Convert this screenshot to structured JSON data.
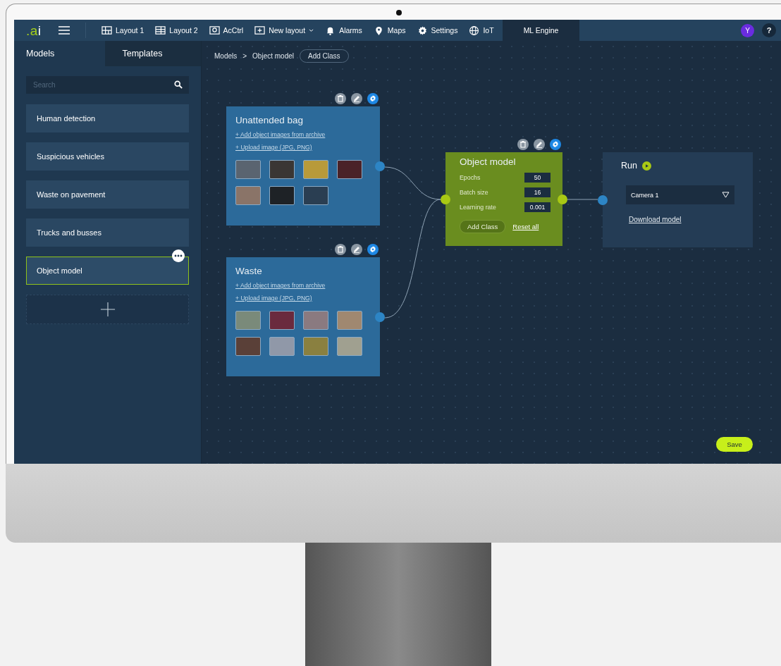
{
  "topbar": {
    "logo": ".ai",
    "nav": [
      {
        "label": "Layout 1",
        "kind": "grid",
        "selected": false
      },
      {
        "label": "Layout 2",
        "kind": "panels",
        "selected": false
      },
      {
        "label": "AcCtrl",
        "kind": "camera",
        "selected": false
      },
      {
        "label": "New layout",
        "kind": "add",
        "selected": false,
        "has_menu": true
      },
      {
        "label": "Alarms",
        "kind": "bell",
        "selected": false
      },
      {
        "label": "Maps",
        "kind": "pin",
        "selected": false
      },
      {
        "label": "Settings",
        "kind": "gear",
        "selected": false
      },
      {
        "label": "IoT",
        "kind": "globe",
        "selected": false
      },
      {
        "label": "ML Engine",
        "kind": "none",
        "selected": true
      }
    ],
    "avatar": "Y",
    "help": "?"
  },
  "sidebar": {
    "tabs": [
      {
        "label": "Models",
        "selected": true
      },
      {
        "label": "Templates",
        "selected": false
      }
    ],
    "search": {
      "placeholder": "Search"
    },
    "items": [
      {
        "label": "Human detection",
        "selected": false
      },
      {
        "label": "Suspicious vehicles",
        "selected": false
      },
      {
        "label": "Waste on pavement",
        "selected": false
      },
      {
        "label": "Trucks and busses",
        "selected": false
      },
      {
        "label": "Object model",
        "selected": true
      }
    ]
  },
  "breadcrumb": {
    "items": [
      "Models",
      "Object model"
    ],
    "separator": ">",
    "button": "Add Class"
  },
  "classes": [
    {
      "title": "Unattended bag",
      "links": [
        "+ Add object images from archive",
        "+ Upload image (JPG, PNG)"
      ],
      "photos": [
        {
          "color": "#5a6470"
        },
        {
          "color": "#3a3634"
        },
        {
          "color": "#b89a3a"
        },
        {
          "color": "#4a2228"
        },
        {
          "color": "#8a7468"
        },
        {
          "color": "#1e2226"
        },
        {
          "color": "#2a3e52"
        }
      ]
    },
    {
      "title": "Waste",
      "links": [
        "+ Add object images from archive",
        "+ Upload image (JPG, PNG)"
      ],
      "photos": [
        {
          "color": "#7a8a7a"
        },
        {
          "color": "#6a2a3e"
        },
        {
          "color": "#8a7a80"
        },
        {
          "color": "#a08870"
        },
        {
          "color": "#5a4038"
        },
        {
          "color": "#9098a8"
        },
        {
          "color": "#8a8040"
        },
        {
          "color": "#a0a090"
        }
      ]
    }
  ],
  "model": {
    "title": "Object model",
    "params": [
      {
        "label": "Epochs",
        "value": "50"
      },
      {
        "label": "Batch size",
        "value": "16"
      },
      {
        "label": "Learning rate",
        "value": "0.001"
      }
    ],
    "button": "Add Class",
    "link": "Reset all"
  },
  "run": {
    "title": "Run",
    "camera": "Camera 1",
    "link": "Download model"
  },
  "save": "Save"
}
